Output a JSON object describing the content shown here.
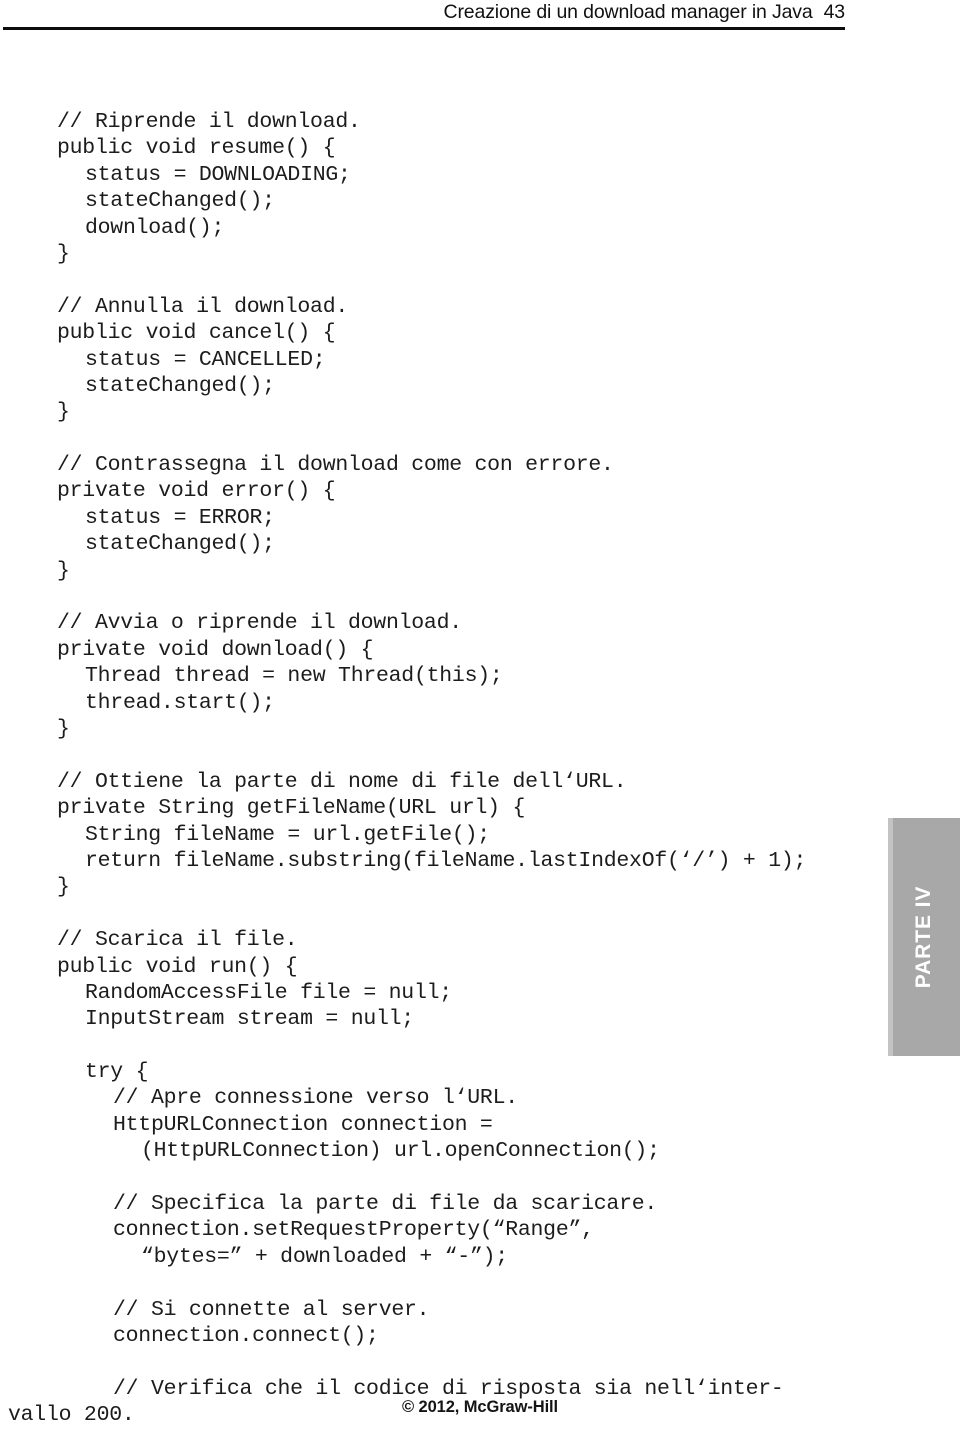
{
  "running_head": {
    "title": "Creazione di un download manager in Java",
    "page_number": "43"
  },
  "code": {
    "language": "java",
    "lines": [
      {
        "text": "// Riprende il download.",
        "indent": 0
      },
      {
        "text": "public void resume() {",
        "indent": 0
      },
      {
        "text": "status = DOWNLOADING;",
        "indent": 1
      },
      {
        "text": "stateChanged();",
        "indent": 1
      },
      {
        "text": "download();",
        "indent": 1
      },
      {
        "text": "}",
        "indent": 0
      },
      {
        "text": "",
        "indent": 0
      },
      {
        "text": "// Annulla il download.",
        "indent": 0
      },
      {
        "text": "public void cancel() {",
        "indent": 0
      },
      {
        "text": "status = CANCELLED;",
        "indent": 1
      },
      {
        "text": "stateChanged();",
        "indent": 1
      },
      {
        "text": "}",
        "indent": 0
      },
      {
        "text": "",
        "indent": 0
      },
      {
        "text": "// Contrassegna il download come con errore.",
        "indent": 0
      },
      {
        "text": "private void error() {",
        "indent": 0
      },
      {
        "text": "status = ERROR;",
        "indent": 1
      },
      {
        "text": "stateChanged();",
        "indent": 1
      },
      {
        "text": "}",
        "indent": 0
      },
      {
        "text": "",
        "indent": 0
      },
      {
        "text": "// Avvia o riprende il download.",
        "indent": 0
      },
      {
        "text": "private void download() {",
        "indent": 0
      },
      {
        "text": "Thread thread = new Thread(this);",
        "indent": 1
      },
      {
        "text": "thread.start();",
        "indent": 1
      },
      {
        "text": "}",
        "indent": 0
      },
      {
        "text": "",
        "indent": 0
      },
      {
        "text": "// Ottiene la parte di nome di file dell‘URL.",
        "indent": 0
      },
      {
        "text": "private String getFileName(URL url) {",
        "indent": 0
      },
      {
        "text": "String fileName = url.getFile();",
        "indent": 1
      },
      {
        "text": "return fileName.substring(fileName.lastIndexOf(‘/’) + 1);",
        "indent": 1
      },
      {
        "text": "}",
        "indent": 0
      },
      {
        "text": "",
        "indent": 0
      },
      {
        "text": "// Scarica il file.",
        "indent": 0
      },
      {
        "text": "public void run() {",
        "indent": 0
      },
      {
        "text": "RandomAccessFile file = null;",
        "indent": 1
      },
      {
        "text": "InputStream stream = null;",
        "indent": 1
      },
      {
        "text": "",
        "indent": 0
      },
      {
        "text": "try {",
        "indent": 1
      },
      {
        "text": "// Apre connessione verso l‘URL.",
        "indent": 2
      },
      {
        "text": "HttpURLConnection connection =",
        "indent": 2
      },
      {
        "text": "(HttpURLConnection) url.openConnection();",
        "indent": 3
      },
      {
        "text": "",
        "indent": 0
      },
      {
        "text": "// Specifica la parte di file da scaricare.",
        "indent": 2
      },
      {
        "text": "connection.setRequestProperty(“Range”,",
        "indent": 2
      },
      {
        "text": "“bytes=” + downloaded + “-”);",
        "indent": 3
      },
      {
        "text": "",
        "indent": 0
      },
      {
        "text": "// Si connette al server.",
        "indent": 2
      },
      {
        "text": "connection.connect();",
        "indent": 2
      },
      {
        "text": "",
        "indent": 0
      },
      {
        "text": "// Verifica che il codice di risposta sia nell‘inter-",
        "indent": 2
      },
      {
        "text": "vallo 200.",
        "indent": -1
      }
    ]
  },
  "part_tab": {
    "label": "PARTE IV",
    "background_color": "#a8a8a8",
    "text_color": "#ffffff"
  },
  "footer": {
    "copyright": "© 2012, McGraw-Hill"
  }
}
